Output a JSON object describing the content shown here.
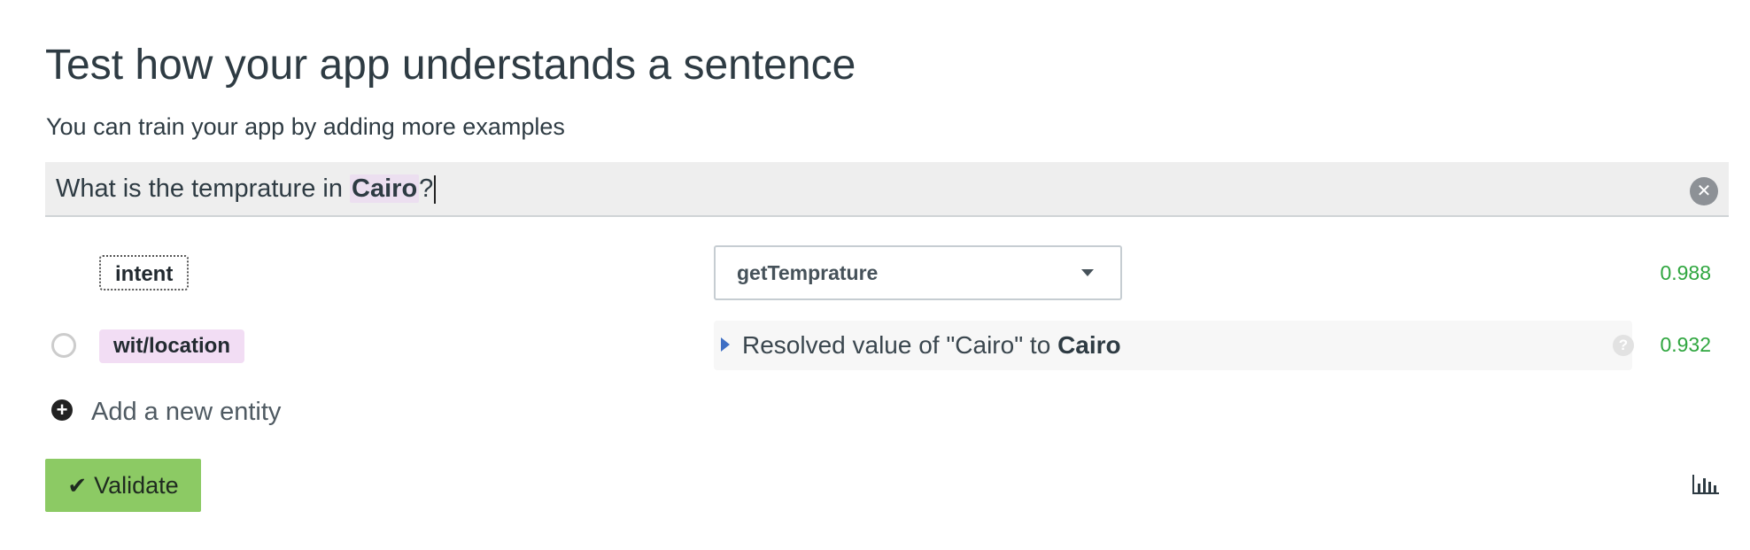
{
  "header": {
    "title": "Test how your app understands a sentence",
    "subtitle": "You can train your app by adding more examples"
  },
  "sentence": {
    "before": "What is the temprature in ",
    "entity": "Cairo",
    "after": "?"
  },
  "entities": [
    {
      "name": "intent",
      "value": "getTemprature",
      "confidence": "0.988"
    },
    {
      "name": "wit/location",
      "resolved_prefix": "Resolved value of \"Cairo\" to ",
      "resolved_value": "Cairo",
      "confidence": "0.932"
    }
  ],
  "actions": {
    "add_entity_label": "Add a new entity",
    "validate_label": "Validate"
  },
  "icons": {
    "clear": "close-circle-icon",
    "radio": "radio-toggle-icon",
    "select": "chevron-down-icon",
    "expand": "caret-right-icon",
    "help": "question-circle-icon",
    "add": "plus-circle-icon",
    "validate": "check-icon",
    "stats": "bar-chart-icon"
  },
  "colors": {
    "confidence": "#2fa63f",
    "validate_bg": "#8cca64",
    "entity_highlight": "#ecdff0"
  }
}
